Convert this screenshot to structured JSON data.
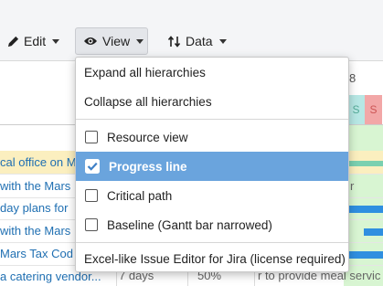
{
  "toolbar": {
    "edit_label": "Edit",
    "view_label": "View",
    "data_label": "Data"
  },
  "timeline": {
    "date_fragment": "8",
    "days": [
      {
        "label": "S",
        "color": "#b7e7e4",
        "text_color": "#5a9"
      },
      {
        "label": "S",
        "color": "#f2a7a7",
        "text_color": "#c55"
      }
    ]
  },
  "rows": [
    {
      "text": "cal office on M",
      "highlight": true
    },
    {
      "text": "with the Mars",
      "highlight": false
    },
    {
      "text": " day plans for",
      "highlight": false
    },
    {
      "text": "with the Mars",
      "highlight": false
    },
    {
      "text": "Mars Tax Cod",
      "highlight": false
    },
    {
      "text": "a catering vendor...",
      "highlight": false
    }
  ],
  "bottom_row": {
    "duration": "7 days",
    "progress": "50%",
    "description": "r to provide meal servic"
  },
  "side_letters": [
    {
      "text": "r"
    }
  ],
  "view_menu": {
    "items": [
      {
        "type": "action",
        "label": "Expand all hierarchies"
      },
      {
        "type": "action",
        "label": "Collapse all hierarchies"
      },
      {
        "type": "separator"
      },
      {
        "type": "checkbox",
        "label": "Resource view",
        "checked": false
      },
      {
        "type": "checkbox",
        "label": "Progress line",
        "checked": true,
        "selected": true
      },
      {
        "type": "checkbox",
        "label": "Critical path",
        "checked": false
      },
      {
        "type": "checkbox",
        "label": "Baseline (Gantt bar narrowed)",
        "checked": false
      },
      {
        "type": "separator"
      },
      {
        "type": "action",
        "label": "Excel-like Issue Editor for Jira (license required)"
      }
    ]
  },
  "colors": {
    "accent": "#6aa4dd",
    "link": "#1f6fb2",
    "highlight_row": "#fbefbf",
    "gantt_bg": "#d8f5d2",
    "gantt_bar": "#2f8fe0"
  }
}
